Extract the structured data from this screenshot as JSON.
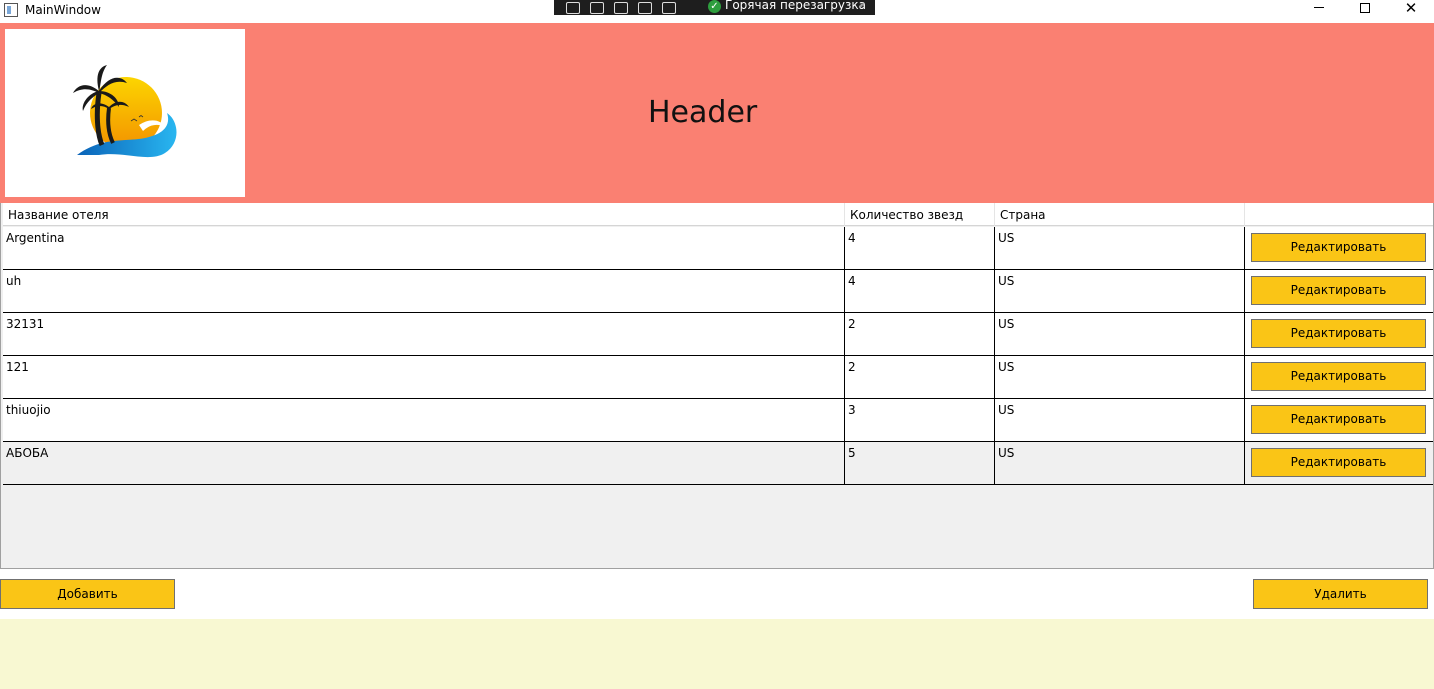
{
  "window": {
    "title": "MainWindow",
    "debug_toolbar_label": "Горячая перезагрузка",
    "controls": [
      "minimize",
      "maximize",
      "close"
    ]
  },
  "header": {
    "title": "Header",
    "logo": "palm-sun-wave-logo"
  },
  "table": {
    "columns": [
      "Название отеля",
      "Количество звезд",
      "Страна",
      ""
    ],
    "rows": [
      {
        "name": "Argentina",
        "stars": "4",
        "country": "US",
        "action": "Редактировать"
      },
      {
        "name": "uh",
        "stars": "4",
        "country": "US",
        "action": "Редактировать"
      },
      {
        "name": "32131",
        "stars": "2",
        "country": "US",
        "action": "Редактировать"
      },
      {
        "name": "121",
        "stars": "2",
        "country": "US",
        "action": "Редактировать"
      },
      {
        "name": "thiuojio",
        "stars": "3",
        "country": "US",
        "action": "Редактировать"
      },
      {
        "name": "АБОБА",
        "stars": "5",
        "country": "US",
        "action": "Редактировать"
      }
    ]
  },
  "actions": {
    "add_label": "Добавить",
    "delete_label": "Удалить"
  },
  "colors": {
    "header_bg": "#fa8072",
    "button_bg": "#fac516",
    "footer_bg": "#f8f8d2"
  }
}
